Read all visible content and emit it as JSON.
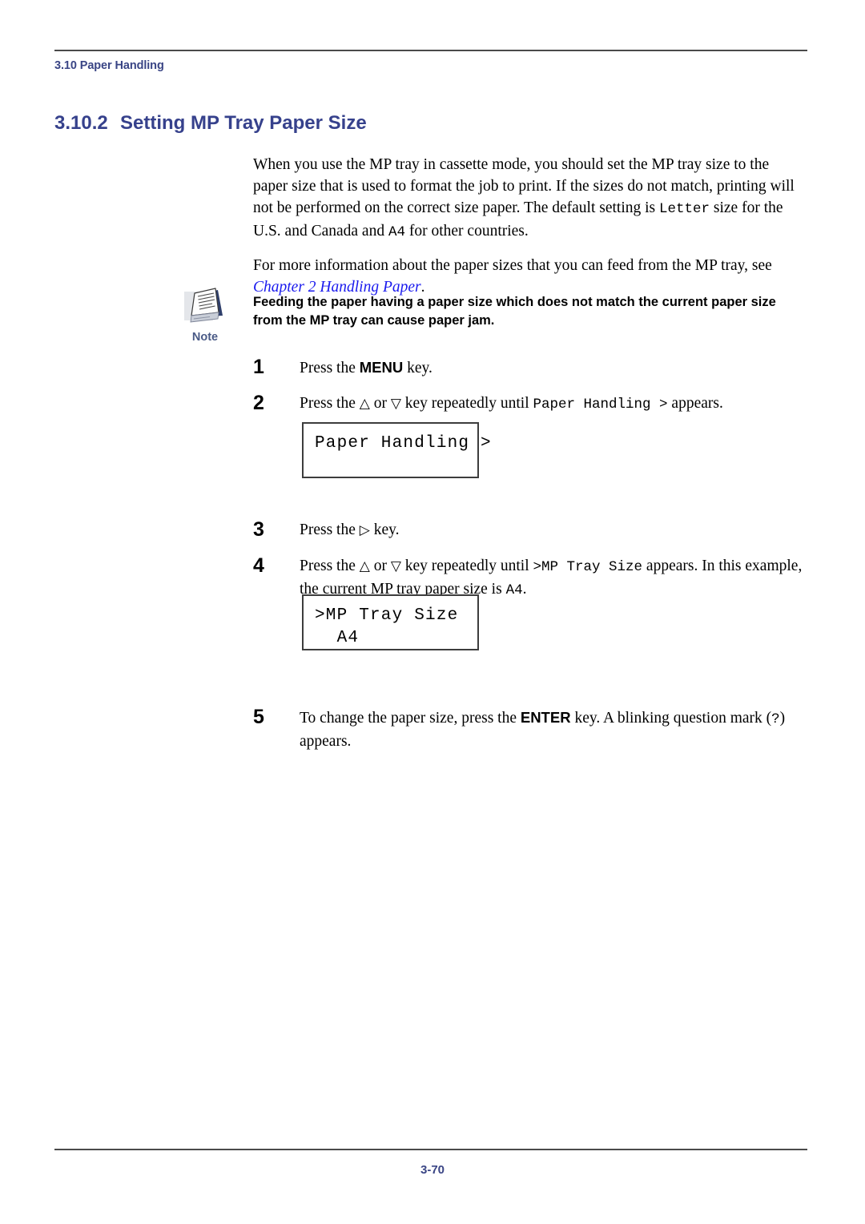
{
  "header": {
    "running_head": "3.10 Paper Handling"
  },
  "section": {
    "number": "3.10.2",
    "title": "Setting MP Tray Paper Size"
  },
  "body": {
    "para1_a": "When you use the MP tray in cassette mode, you should set the MP tray size to the paper size that is used to format the job to print. If the sizes do not match, printing will not be performed on the correct size paper. The default setting is ",
    "para1_code1": "Letter",
    "para1_b": " size for the U.S. and Canada and ",
    "para1_code2": "A4",
    "para1_c": " for other countries.",
    "para2_a": "For more information about the paper sizes that you can feed from the MP tray, see ",
    "para2_link": "Chapter 2 Handling Paper",
    "para2_b": "."
  },
  "note": {
    "icon": "note-document-icon",
    "label": "Note",
    "text": "Feeding the paper having a paper size which does not match the current paper size from the MP tray can cause paper jam."
  },
  "steps": [
    {
      "number": "1",
      "text_a": "Press the ",
      "keycap": "MENU",
      "text_b": " key."
    },
    {
      "number": "2",
      "text_a": "Press the ",
      "tri_up": "△",
      "text_mid": " or ",
      "tri_down": "▽",
      "text_b": " key repeatedly until ",
      "code": "Paper Handling >",
      "text_c": " appears."
    },
    {
      "number": "3",
      "text_a": "Press the ",
      "tri_right": "▷",
      "text_b": " key."
    },
    {
      "number": "4",
      "text_a": "Press the ",
      "tri_up": "△",
      "text_mid": " or ",
      "tri_down": "▽",
      "text_b": " key repeatedly until ",
      "code": ">MP Tray Size",
      "text_c": " appears. In this example, the current MP tray paper size is ",
      "code2": "A4",
      "text_d": "."
    },
    {
      "number": "5",
      "text_a": "To change the paper size, press the ",
      "keycap": "ENTER",
      "text_b": " key. A blinking question mark (",
      "code": "?",
      "text_c": ") appears."
    }
  ],
  "lcd_panels": [
    {
      "line1": "Paper Handling >",
      "line2": ""
    },
    {
      "line1": ">MP Tray Size",
      "line2": "  A4"
    }
  ],
  "footer": {
    "page_number": "3-70"
  },
  "colors": {
    "heading_blue": "#36418c",
    "running_head_blue": "#3a4585",
    "link_blue": "#1a1aee",
    "note_label_blue": "#4a5a86",
    "rule_gray": "#4a4a4a"
  }
}
